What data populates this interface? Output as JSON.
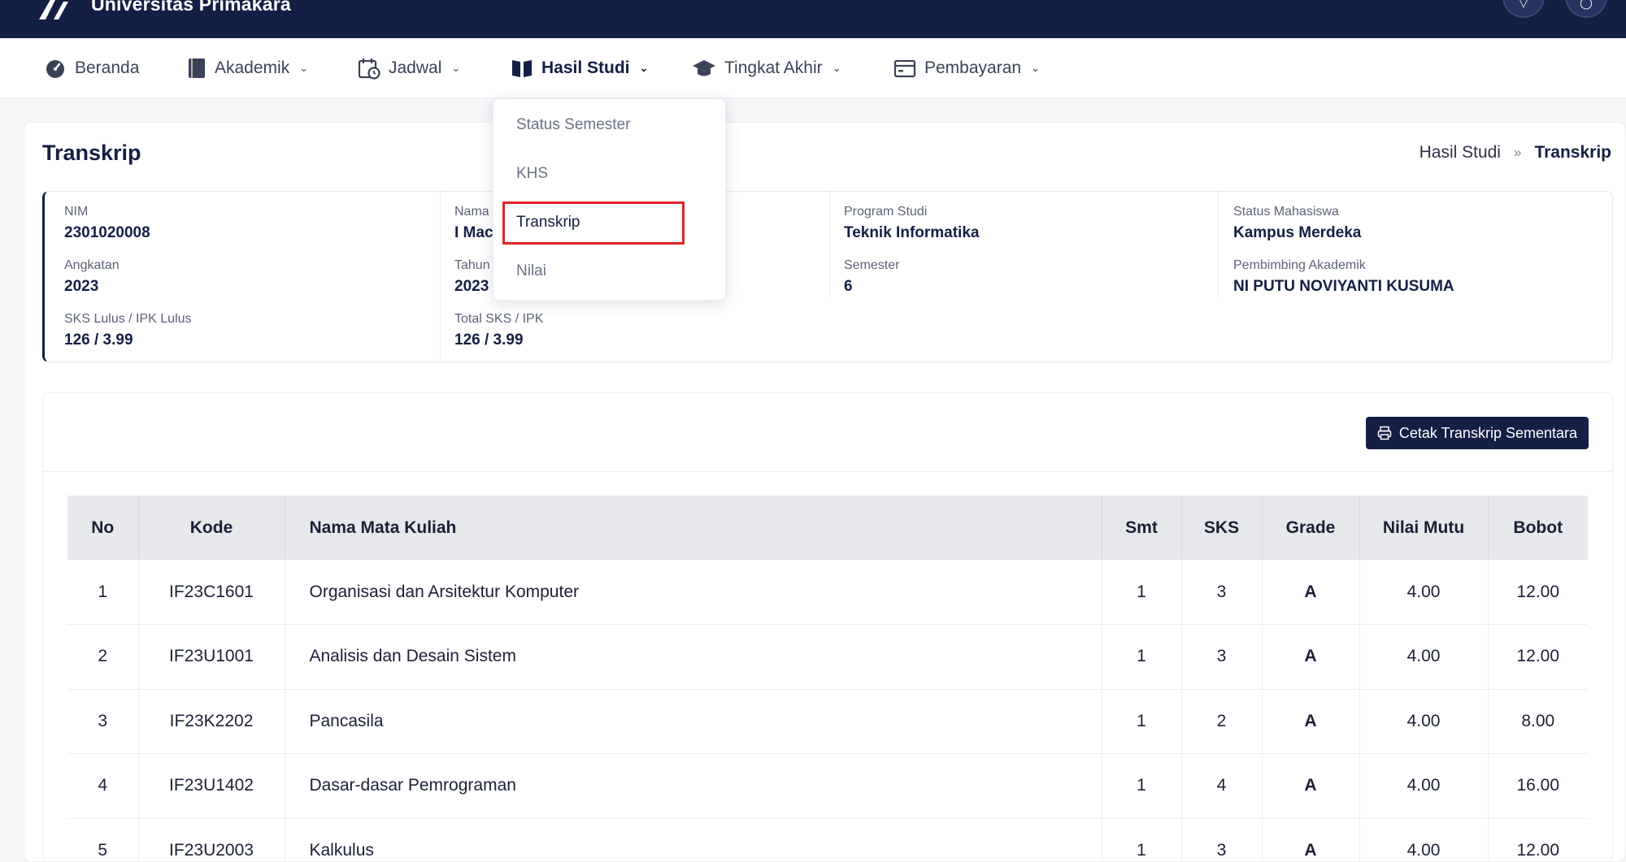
{
  "header": {
    "brand": "Universitas Primakara"
  },
  "nav": {
    "items": [
      {
        "label": "Beranda",
        "icon": "dashboard-icon"
      },
      {
        "label": "Akademik",
        "icon": "book-icon"
      },
      {
        "label": "Jadwal",
        "icon": "calendar-clock-icon"
      },
      {
        "label": "Hasil Studi",
        "icon": "open-book-icon"
      },
      {
        "label": "Tingkat Akhir",
        "icon": "graduation-cap-icon"
      },
      {
        "label": "Pembayaran",
        "icon": "wallet-icon"
      }
    ],
    "active": "Hasil Studi"
  },
  "dropdown": {
    "items": [
      "Status Semester",
      "KHS",
      "Transkrip",
      "Nilai"
    ],
    "selected": "Transkrip"
  },
  "page": {
    "title": "Transkrip",
    "breadcrumb": {
      "parent": "Hasil Studi",
      "separator": "»",
      "current": "Transkrip"
    }
  },
  "student": {
    "nim": {
      "label": "NIM",
      "value": "2301020008"
    },
    "angkatan": {
      "label": "Angkatan",
      "value": "2023"
    },
    "sks_lulus": {
      "label": "SKS Lulus / IPK Lulus",
      "value": "126 / 3.99"
    },
    "nama": {
      "label": "Nama",
      "value": "I Mac"
    },
    "tahun": {
      "label": "Tahun",
      "value": "2023"
    },
    "total_sks": {
      "label": "Total SKS / IPK",
      "value": "126 / 3.99"
    },
    "prodi": {
      "label": "Program Studi",
      "value": "Teknik Informatika"
    },
    "semester": {
      "label": "Semester",
      "value": "6"
    },
    "status": {
      "label": "Status Mahasiswa",
      "value": "Kampus Merdeka"
    },
    "pembimbing": {
      "label": "Pembimbing Akademik",
      "value": "NI PUTU NOVIYANTI KUSUMA"
    }
  },
  "actions": {
    "print_label": "Cetak Transkrip Sementara"
  },
  "table": {
    "columns": [
      "No",
      "Kode",
      "Nama Mata Kuliah",
      "Smt",
      "SKS",
      "Grade",
      "Nilai Mutu",
      "Bobot"
    ],
    "rows": [
      [
        "1",
        "IF23C1601",
        "Organisasi dan Arsitektur Komputer",
        "1",
        "3",
        "A",
        "4.00",
        "12.00"
      ],
      [
        "2",
        "IF23U1001",
        "Analisis dan Desain Sistem",
        "1",
        "3",
        "A",
        "4.00",
        "12.00"
      ],
      [
        "3",
        "IF23K2202",
        "Pancasila",
        "1",
        "2",
        "A",
        "4.00",
        "8.00"
      ],
      [
        "4",
        "IF23U1402",
        "Dasar-dasar Pemrograman",
        "1",
        "4",
        "A",
        "4.00",
        "16.00"
      ],
      [
        "5",
        "IF23U2003",
        "Kalkulus",
        "1",
        "3",
        "A",
        "4.00",
        "12.00"
      ]
    ]
  },
  "colors": {
    "primary": "#141f44",
    "highlight": "#e0242b"
  }
}
